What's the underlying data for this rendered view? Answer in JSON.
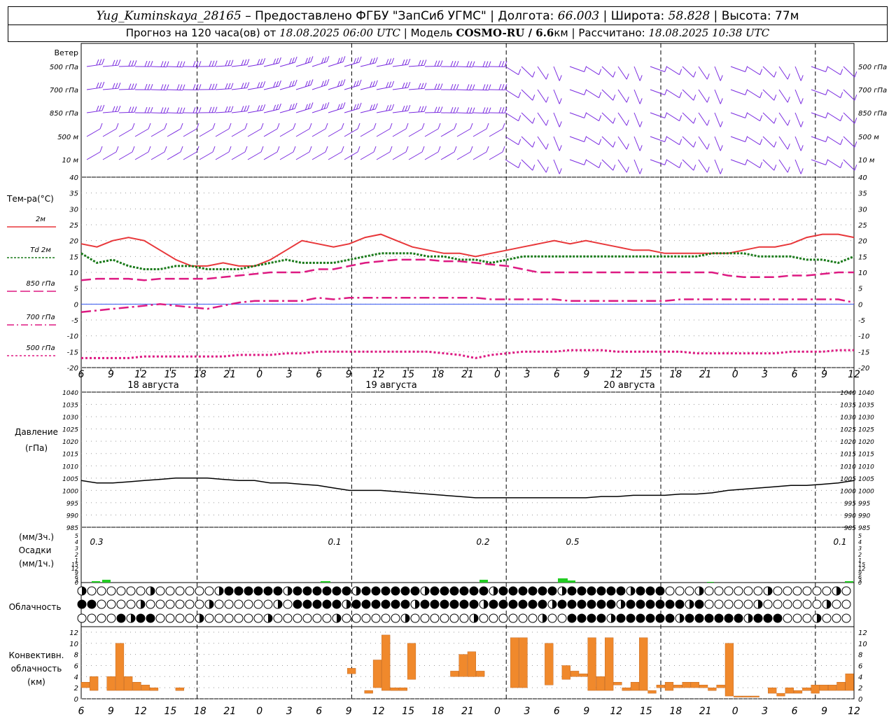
{
  "header": {
    "station": "Yug_Kuminskaya_28165",
    "provided_label": "– Предоставлено ФГБУ \"ЗапСиб УГМС\"",
    "lon_label": "Долгота:",
    "lon_value": "66.003",
    "lat_label": "Широта:",
    "lat_value": "58.828",
    "alt_label": "Высота:",
    "alt_value": "77м",
    "forecast_label": "Прогноз на 120 часа(ов)  от",
    "start_time": "18.08.2025 06:00 UTC",
    "model_label": "Модель",
    "model_name": "COSMO-RU / 6.6",
    "model_unit": "км",
    "calc_label": "Рассчитано:",
    "calc_time": "18.08.2025 10:38 UTC"
  },
  "time_axis": {
    "tick_labels": [
      "6",
      "9",
      "12",
      "15",
      "18",
      "21",
      "0",
      "3",
      "6",
      "9",
      "12",
      "15",
      "18",
      "21",
      "0",
      "3",
      "6",
      "9",
      "12",
      "15",
      "18",
      "21",
      "0",
      "3",
      "6",
      "9",
      "12"
    ],
    "date_labels": [
      "18 августа",
      "19 августа",
      "20 августа"
    ]
  },
  "wind_panel": {
    "title": "Ветер",
    "levels": [
      "500 гПа",
      "700 гПа",
      "850 гПа",
      "500 м",
      "10  м"
    ],
    "color": "#7a2be0"
  },
  "temp_panel": {
    "title": "Тем-ра(°C)",
    "legend": [
      {
        "label": "2м",
        "color": "#e8373a"
      },
      {
        "label": "Td  2м",
        "color": "#1a7a1a"
      },
      {
        "label": "850 гПа",
        "color": "#dd1a82"
      },
      {
        "label": "700 гПа",
        "color": "#dd1a82"
      },
      {
        "label": "500 гПа",
        "color": "#dd1a82"
      }
    ],
    "y_ticks": [
      "40",
      "35",
      "30",
      "25",
      "20",
      "15",
      "10",
      "5",
      "0",
      "-5",
      "-10",
      "-15",
      "-20"
    ]
  },
  "pressure_panel": {
    "title": "Давление",
    "unit": "(гПа)",
    "y_ticks": [
      "1040",
      "1035",
      "1030",
      "1025",
      "1020",
      "1015",
      "1010",
      "1005",
      "1000",
      "995",
      "990",
      "985"
    ]
  },
  "precip_panel": {
    "unit_top": "(мм/3ч.)",
    "title": "Осадки",
    "unit_bottom": "(мм/1ч.)",
    "y_ticks": [
      "5",
      "4",
      "3",
      "2",
      "1",
      "15",
      "12",
      "9",
      "6",
      "3",
      "0"
    ],
    "annotations": [
      "0.3",
      "0.1",
      "0.2",
      "0.5",
      "0.1"
    ]
  },
  "cloud_panel": {
    "title": "Облачность"
  },
  "conv_panel": {
    "title_line1": "Конвективн.",
    "title_line2": "облачность",
    "unit": "(км)",
    "y_ticks": [
      "12",
      "10",
      "8",
      "6",
      "4",
      "2",
      "0"
    ],
    "color": "#f0892c"
  },
  "chart_data": [
    {
      "type": "line",
      "title": "Тем-ра(°C)",
      "x_hours_from_start": [
        0,
        3,
        6,
        9,
        12,
        15,
        18,
        21,
        24,
        27,
        30,
        33,
        36,
        39,
        42,
        45,
        48,
        51,
        54,
        57,
        60,
        63,
        66,
        69,
        72,
        75,
        78,
        81,
        84,
        87,
        90,
        93,
        96,
        99,
        102,
        105,
        108,
        111,
        114,
        117,
        120
      ],
      "ylim": [
        -20,
        40
      ],
      "series": [
        {
          "name": "2м",
          "values": [
            19,
            18,
            20,
            21,
            20,
            17,
            14,
            12,
            12,
            13,
            12,
            12,
            14,
            17,
            20,
            19,
            18,
            19,
            21,
            22,
            20,
            18,
            17,
            16,
            16,
            15,
            16,
            17,
            18,
            19,
            20,
            19,
            20,
            19,
            18,
            17,
            17,
            16,
            16,
            16,
            16,
            16,
            17,
            18,
            18,
            19,
            21,
            22,
            22,
            21
          ]
        },
        {
          "name": "Td 2м",
          "values": [
            16,
            13,
            14,
            12,
            11,
            11,
            12,
            12,
            11,
            11,
            11,
            12,
            13,
            14,
            13,
            13,
            13,
            14,
            15,
            16,
            16,
            16,
            15,
            15,
            14,
            14,
            13,
            14,
            15,
            15,
            15,
            15,
            15,
            15,
            15,
            15,
            15,
            15,
            15,
            15,
            16,
            16,
            16,
            15,
            15,
            15,
            14,
            14,
            13,
            15
          ]
        },
        {
          "name": "850 гПа",
          "values": [
            7.5,
            8,
            8,
            8,
            7.5,
            8,
            8,
            8,
            8,
            8.5,
            9,
            9.5,
            10,
            10,
            10,
            11,
            11,
            12,
            13,
            13.5,
            14,
            14,
            14,
            13.5,
            13.5,
            13,
            12.5,
            12,
            11,
            10,
            10,
            10,
            10,
            10,
            10,
            10,
            10,
            10,
            10,
            10,
            10,
            9,
            8.5,
            8.5,
            8.5,
            9,
            9,
            9.5,
            10,
            10
          ]
        },
        {
          "name": "700 гПа",
          "values": [
            -2.5,
            -2,
            -1.5,
            -1,
            -0.5,
            0,
            -0.5,
            -1,
            -1.5,
            -0.5,
            0.5,
            1,
            1,
            1,
            1,
            2,
            1.5,
            2,
            2,
            2,
            2,
            2,
            2,
            2,
            2,
            2,
            1.5,
            1.5,
            1.5,
            1.5,
            1.5,
            1,
            1,
            1,
            1,
            1,
            1,
            1,
            1.5,
            1.5,
            1.5,
            1.5,
            1.5,
            1.5,
            1.5,
            1.5,
            1.5,
            1.5,
            1.5,
            0.5
          ]
        },
        {
          "name": "500 гПа",
          "values": [
            -17,
            -17,
            -17,
            -17,
            -16.5,
            -16.5,
            -16.5,
            -16.5,
            -16.5,
            -16.5,
            -16,
            -16,
            -16,
            -15.5,
            -15.5,
            -15,
            -15,
            -15,
            -15,
            -15,
            -15,
            -15,
            -15,
            -15.5,
            -16,
            -17,
            -16,
            -15.5,
            -15,
            -15,
            -15,
            -14.5,
            -14.5,
            -14.5,
            -15,
            -15,
            -15,
            -15,
            -15,
            -15.5,
            -15.5,
            -15.5,
            -15.5,
            -15.5,
            -15.5,
            -15,
            -15,
            -15,
            -14.5,
            -14.5
          ]
        }
      ]
    },
    {
      "type": "line",
      "title": "Давление",
      "ylabel": "(гПа)",
      "ylim": [
        985,
        1040
      ],
      "series": [
        {
          "name": "Давление",
          "values": [
            1004,
            1003,
            1003,
            1003.5,
            1004,
            1004.5,
            1005,
            1005,
            1005,
            1004.5,
            1004,
            1004,
            1003,
            1003,
            1002.5,
            1002,
            1001,
            1000,
            1000,
            1000,
            999.5,
            999,
            998.5,
            998,
            997.5,
            997,
            997,
            997,
            997,
            997,
            997,
            997,
            997,
            997.5,
            997.5,
            998,
            998,
            998,
            998.5,
            998.5,
            999,
            1000,
            1000.5,
            1001,
            1001.5,
            1002,
            1002,
            1002.5,
            1003,
            1004
          ]
        }
      ]
    },
    {
      "type": "bar",
      "title": "Осадки",
      "ylabel": "(мм/1ч.)",
      "annotations": [
        {
          "hour": 1,
          "label": "0.3"
        },
        {
          "hour": 41,
          "label": "0.1"
        },
        {
          "hour": 67,
          "label": "0.2"
        },
        {
          "hour": 82,
          "label": "0.5"
        },
        {
          "hour": 119,
          "label": "0.1"
        }
      ]
    },
    {
      "type": "bar",
      "title": "Конвективн. облачность",
      "ylabel": "(км)",
      "ylim": [
        0,
        13
      ],
      "bars": [
        {
          "hour": 0,
          "base": 2.0,
          "top": 3.0
        },
        {
          "hour": 1,
          "base": 1.5,
          "top": 4.0
        },
        {
          "hour": 3,
          "base": 1.5,
          "top": 4.0
        },
        {
          "hour": 4,
          "base": 1.5,
          "top": 10.0
        },
        {
          "hour": 5,
          "base": 1.5,
          "top": 4.0
        },
        {
          "hour": 6,
          "base": 1.5,
          "top": 3.0
        },
        {
          "hour": 7,
          "base": 1.5,
          "top": 2.5
        },
        {
          "hour": 8,
          "base": 1.5,
          "top": 2.0
        },
        {
          "hour": 11,
          "base": 1.5,
          "top": 2.0
        },
        {
          "hour": 31,
          "base": 4.5,
          "top": 5.5
        },
        {
          "hour": 33,
          "base": 1.0,
          "top": 1.5
        },
        {
          "hour": 34,
          "base": 2.0,
          "top": 7.0
        },
        {
          "hour": 35,
          "base": 1.5,
          "top": 11.5
        },
        {
          "hour": 36,
          "base": 1.5,
          "top": 2.0
        },
        {
          "hour": 37,
          "base": 1.5,
          "top": 2.0
        },
        {
          "hour": 38,
          "base": 3.5,
          "top": 10.0
        },
        {
          "hour": 43,
          "base": 4.0,
          "top": 5.0
        },
        {
          "hour": 44,
          "base": 4.0,
          "top": 8.0
        },
        {
          "hour": 45,
          "base": 4.0,
          "top": 8.5
        },
        {
          "hour": 46,
          "base": 4.0,
          "top": 5.0
        },
        {
          "hour": 50,
          "base": 2.0,
          "top": 11.0
        },
        {
          "hour": 51,
          "base": 2.0,
          "top": 11.0
        },
        {
          "hour": 54,
          "base": 2.5,
          "top": 10.0
        },
        {
          "hour": 56,
          "base": 3.5,
          "top": 6.0
        },
        {
          "hour": 57,
          "base": 4.0,
          "top": 5.0
        },
        {
          "hour": 58,
          "base": 4.0,
          "top": 4.5
        },
        {
          "hour": 59,
          "base": 1.5,
          "top": 11.0
        },
        {
          "hour": 60,
          "base": 1.5,
          "top": 4.0
        },
        {
          "hour": 61,
          "base": 1.5,
          "top": 11.0
        },
        {
          "hour": 62,
          "base": 2.5,
          "top": 3.0
        },
        {
          "hour": 63,
          "base": 1.5,
          "top": 2.0
        },
        {
          "hour": 64,
          "base": 1.5,
          "top": 3.0
        },
        {
          "hour": 65,
          "base": 1.5,
          "top": 11.0
        },
        {
          "hour": 66,
          "base": 1.0,
          "top": 1.5
        },
        {
          "hour": 67,
          "base": 2.0,
          "top": 2.5
        },
        {
          "hour": 68,
          "base": 1.5,
          "top": 3.0
        },
        {
          "hour": 69,
          "base": 2.0,
          "top": 2.5
        },
        {
          "hour": 70,
          "base": 2.0,
          "top": 3.0
        },
        {
          "hour": 71,
          "base": 2.0,
          "top": 3.0
        },
        {
          "hour": 72,
          "base": 2.0,
          "top": 2.5
        },
        {
          "hour": 73,
          "base": 1.5,
          "top": 2.0
        },
        {
          "hour": 74,
          "base": 2.0,
          "top": 2.5
        },
        {
          "hour": 75,
          "base": 0.5,
          "top": 10.0
        },
        {
          "hour": 76,
          "base": 0.3,
          "top": 0.5
        },
        {
          "hour": 77,
          "base": 0.3,
          "top": 0.5
        },
        {
          "hour": 78,
          "base": 0.3,
          "top": 0.5
        },
        {
          "hour": 80,
          "base": 1.0,
          "top": 2.0
        },
        {
          "hour": 81,
          "base": 0.5,
          "top": 1.0
        },
        {
          "hour": 82,
          "base": 1.0,
          "top": 2.0
        },
        {
          "hour": 83,
          "base": 1.0,
          "top": 1.5
        },
        {
          "hour": 84,
          "base": 1.5,
          "top": 2.0
        },
        {
          "hour": 85,
          "base": 1.0,
          "top": 2.5
        },
        {
          "hour": 86,
          "base": 1.5,
          "top": 2.5
        },
        {
          "hour": 87,
          "base": 1.5,
          "top": 2.5
        },
        {
          "hour": 88,
          "base": 1.5,
          "top": 3.0
        },
        {
          "hour": 89,
          "base": 1.5,
          "top": 4.5
        }
      ]
    }
  ]
}
